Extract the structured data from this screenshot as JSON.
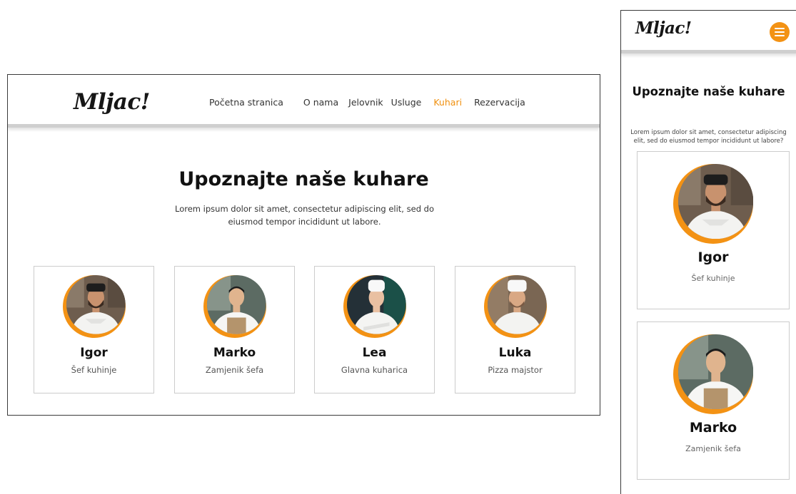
{
  "brand": {
    "logo": "Mljac!",
    "accent": "#f39214",
    "ring_color": "#f39214"
  },
  "nav": {
    "items": [
      {
        "label": "Početna stranica"
      },
      {
        "label": "O nama"
      },
      {
        "label": "Jelovnik"
      },
      {
        "label": "Usluge"
      },
      {
        "label": "Kuhari"
      },
      {
        "label": "Rezervacija"
      }
    ],
    "active": "Kuhari"
  },
  "desktop": {
    "title": "Upoznajte naše kuhare",
    "subtitle": "Lorem ipsum dolor sit amet, consectetur adipiscing elit, sed do eiusmod tempor incididunt ut labore."
  },
  "mobile": {
    "title": "Upoznajte naše kuhare",
    "subtitle": "Lorem ipsum dolor sit amet, consectetur adipiscing elit, sed do eiusmod tempor incididunt ut labore?",
    "menu_icon": "hamburger-icon"
  },
  "chefs": [
    {
      "name": "Igor",
      "role": "Šef kuhinje",
      "photo_icon": "chef-photo-icon"
    },
    {
      "name": "Marko",
      "role": "Zamjenik šefa",
      "photo_icon": "chef-photo-icon"
    },
    {
      "name": "Lea",
      "role": "Glavna kuharica",
      "photo_icon": "chef-photo-icon"
    },
    {
      "name": "Luka",
      "role": "Pizza majstor",
      "photo_icon": "chef-photo-icon"
    }
  ]
}
